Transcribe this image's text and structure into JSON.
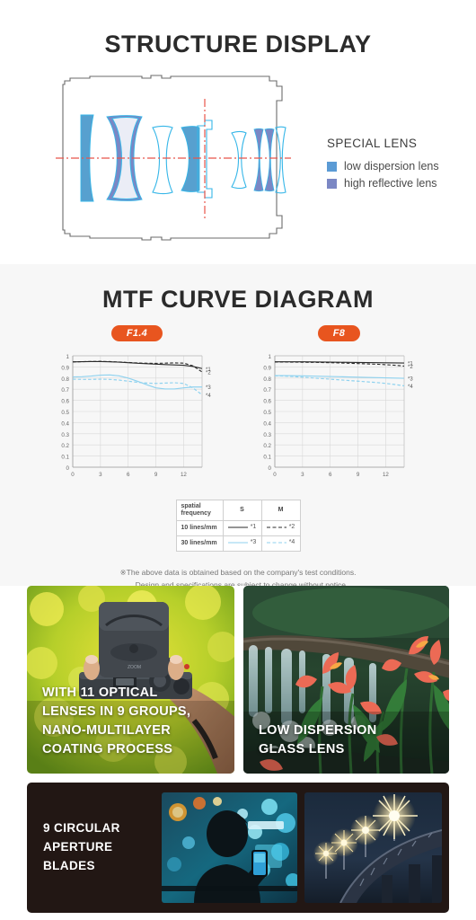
{
  "structure": {
    "title": "STRUCTURE DISPLAY",
    "legend": {
      "title": "SPECIAL LENS",
      "items": [
        {
          "label": "low dispersion lens",
          "color": "#5b9bd5",
          "swatch_name": "low-dispersion-swatch"
        },
        {
          "label": "high reflective lens",
          "color": "#7b87c4",
          "swatch_name": "high-reflective-swatch"
        }
      ]
    },
    "diagram": {
      "axis_color": "#e8554a",
      "outline_color": "#6b6b6b",
      "low_dispersion_fill": "#5b9bd5",
      "high_reflective_fill": "#7b87c4",
      "lens_outline": "#35b6e8"
    }
  },
  "mtf": {
    "title": "MTF CURVE DIAGRAM",
    "badges": [
      "F1.4",
      "F8"
    ],
    "badge_color": "#e8551f",
    "table": {
      "header": [
        "spatial\nfrequency",
        "S",
        "M"
      ],
      "rows": [
        {
          "freq": "10 lines/mm",
          "s": "*1",
          "m": "*2",
          "s_style": "solid-black",
          "m_style": "dashed-black"
        },
        {
          "freq": "30 lines/mm",
          "s": "*3",
          "m": "*4",
          "s_style": "solid-blue",
          "m_style": "dashed-blue"
        }
      ]
    },
    "footnote_line1": "※The above data is obtained based on the company's test conditions.",
    "footnote_line2": "Design and specifications are subject to change without notice."
  },
  "chart_data": [
    {
      "type": "line",
      "title": "F1.4",
      "xlabel": "",
      "ylabel": "",
      "xlim": [
        0,
        14
      ],
      "ylim": [
        0,
        1
      ],
      "xticks": [
        0,
        3,
        6,
        9,
        12
      ],
      "yticks": [
        0,
        0.1,
        0.2,
        0.3,
        0.4,
        0.5,
        0.6,
        0.7,
        0.8,
        0.9,
        1
      ],
      "grid": true,
      "legend_position": "right",
      "x": [
        0,
        1,
        2,
        3,
        4,
        5,
        6,
        7,
        8,
        9,
        10,
        11,
        12,
        13,
        14
      ],
      "series": [
        {
          "name": "*1",
          "style": "solid",
          "color": "#2b2b2b",
          "values": [
            0.945,
            0.947,
            0.948,
            0.948,
            0.946,
            0.943,
            0.938,
            0.933,
            0.929,
            0.925,
            0.921,
            0.918,
            0.915,
            0.905,
            0.885
          ]
        },
        {
          "name": "*2",
          "style": "dashed",
          "color": "#2b2b2b",
          "values": [
            0.945,
            0.947,
            0.949,
            0.95,
            0.948,
            0.944,
            0.94,
            0.936,
            0.933,
            0.932,
            0.934,
            0.936,
            0.934,
            0.91,
            0.855
          ]
        },
        {
          "name": "*3",
          "style": "solid",
          "color": "#8fd2ef",
          "values": [
            0.81,
            0.812,
            0.818,
            0.826,
            0.828,
            0.82,
            0.8,
            0.772,
            0.74,
            0.712,
            0.702,
            0.702,
            0.712,
            0.72,
            0.72
          ]
        },
        {
          "name": "*4",
          "style": "dashed",
          "color": "#8fd2ef",
          "values": [
            0.79,
            0.788,
            0.788,
            0.79,
            0.788,
            0.782,
            0.772,
            0.762,
            0.755,
            0.752,
            0.755,
            0.758,
            0.752,
            0.712,
            0.65
          ]
        }
      ]
    },
    {
      "type": "line",
      "title": "F8",
      "xlabel": "",
      "ylabel": "",
      "xlim": [
        0,
        14
      ],
      "ylim": [
        0,
        1
      ],
      "xticks": [
        0,
        3,
        6,
        9,
        12
      ],
      "yticks": [
        0,
        0.1,
        0.2,
        0.3,
        0.4,
        0.5,
        0.6,
        0.7,
        0.8,
        0.9,
        1
      ],
      "grid": true,
      "legend_position": "right",
      "x": [
        0,
        1,
        2,
        3,
        4,
        5,
        6,
        7,
        8,
        9,
        10,
        11,
        12,
        13,
        14
      ],
      "series": [
        {
          "name": "*1",
          "style": "solid",
          "color": "#2b2b2b",
          "values": [
            0.946,
            0.946,
            0.946,
            0.946,
            0.945,
            0.944,
            0.943,
            0.942,
            0.941,
            0.94,
            0.939,
            0.938,
            0.937,
            0.936,
            0.935
          ]
        },
        {
          "name": "*2",
          "style": "dashed",
          "color": "#2b2b2b",
          "values": [
            0.944,
            0.944,
            0.943,
            0.942,
            0.941,
            0.94,
            0.938,
            0.936,
            0.933,
            0.93,
            0.927,
            0.924,
            0.92,
            0.915,
            0.908
          ]
        },
        {
          "name": "*3",
          "style": "solid",
          "color": "#8fd2ef",
          "values": [
            0.822,
            0.822,
            0.821,
            0.82,
            0.818,
            0.816,
            0.814,
            0.812,
            0.81,
            0.808,
            0.806,
            0.804,
            0.802,
            0.8,
            0.798
          ]
        },
        {
          "name": "*4",
          "style": "dashed",
          "color": "#8fd2ef",
          "values": [
            0.82,
            0.818,
            0.814,
            0.808,
            0.802,
            0.796,
            0.79,
            0.784,
            0.778,
            0.772,
            0.766,
            0.76,
            0.752,
            0.742,
            0.73
          ]
        }
      ]
    }
  ],
  "photos": {
    "camera_flowers": {
      "caption": "WITH 11 OPTICAL\nLENSES IN 9 GROUPS,\nNANO-MULTILAYER\nCOATING PROCESS"
    },
    "waterfall_flowers": {
      "caption": "LOW DISPERSION\nGLASS LENS"
    },
    "aperture_panel": {
      "caption": "9 CIRCULAR\nAPERTURE\nBLADES",
      "background": "#221714"
    }
  }
}
